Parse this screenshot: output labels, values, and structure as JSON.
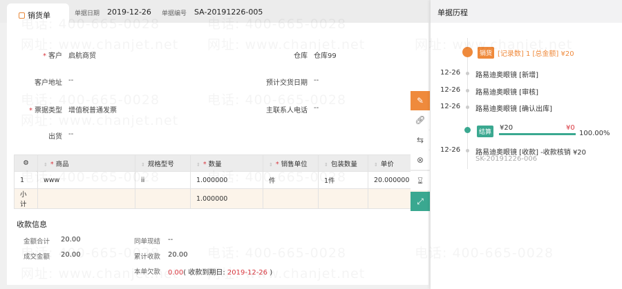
{
  "header": {
    "tab_label": "销货单",
    "date_label": "单据日期",
    "date_value": "2019-12-26",
    "no_label": "单据编号",
    "no_value": "SA-20191226-005"
  },
  "form": {
    "customer_label": "客户",
    "customer_value": "启航商贸",
    "warehouse_label": "仓库",
    "warehouse_value": "仓库99",
    "address_label": "客户地址",
    "address_value": "--",
    "delivery_label": "预计交货日期",
    "delivery_value": "--",
    "invoice_label": "票据类型",
    "invoice_value": "增值税普通发票",
    "phone_label": "主联系人电话",
    "phone_value": "--",
    "shipping_label": "出货",
    "shipping_value": "--"
  },
  "table": {
    "headers": [
      "商品",
      "规格型号",
      "数量",
      "销售单位",
      "包装数量",
      "单价"
    ],
    "row": {
      "index": "1",
      "product": "www",
      "spec": "ii",
      "qty": "1.000000",
      "unit": "件",
      "pack": "1件",
      "price": "20.000000"
    },
    "subtotal": {
      "label": "小计",
      "qty": "1.000000"
    }
  },
  "payment": {
    "title": "收款信息",
    "total_label": "金额合计",
    "total_value": "20.00",
    "deal_label": "成交金额",
    "deal_value": "20.00",
    "cash_label": "同单现结",
    "cash_value": "--",
    "cum_label": "累计收款",
    "cum_value": "20.00",
    "owe_label": "本单欠款",
    "owe_value": "0.00",
    "due_prefix": "( 收款到期日: ",
    "due_date": "2019-12-26",
    "due_suffix": " )"
  },
  "history": {
    "title": "单据历程",
    "sale": {
      "badge": "销货",
      "summary": "[记录数] 1  [总金额] ¥20"
    },
    "entries": [
      {
        "date": "12-26",
        "text": "路易迪奥眼镜 [新增]"
      },
      {
        "date": "12-26",
        "text": "路易迪奥眼镜 [审核]"
      },
      {
        "date": "12-26",
        "text": "路易迪奥眼镜 [确认出库]"
      }
    ],
    "settle": {
      "badge": "结算",
      "paid": "¥20",
      "remain": "¥0",
      "percent": "100.00%",
      "progress": 1.0
    },
    "payment_entry": {
      "date": "12-26",
      "text": "路易迪奥眼镜 [收款] -收款核销  ¥20",
      "code": "SK-20191226-006"
    }
  },
  "watermark": {
    "phone": "电话: 400-665-0028",
    "site": "网址: www.chanjet.net"
  },
  "colors": {
    "accent": "#ef8a3c",
    "teal": "#3aa890",
    "red": "#d9363e"
  }
}
